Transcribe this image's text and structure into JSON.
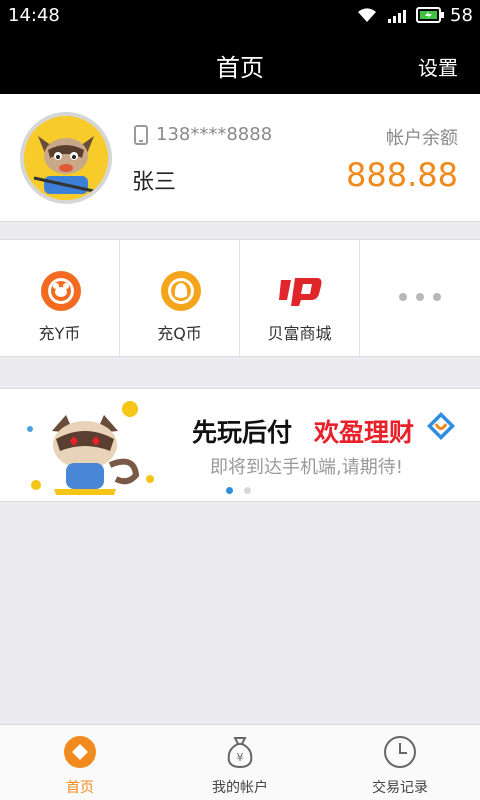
{
  "status_bar": {
    "time": "14:48",
    "battery_percent": "58"
  },
  "navbar": {
    "title": "首页",
    "settings_label": "设置"
  },
  "account": {
    "phone": "138****8888",
    "name": "张三",
    "balance_label": "帐户余额",
    "balance_value": "888.88"
  },
  "shortcuts": [
    {
      "label": "充Y币",
      "icon": "y-coin-icon"
    },
    {
      "label": "充Q币",
      "icon": "q-coin-icon"
    },
    {
      "label": "贝富商城",
      "icon": "up-mall-icon"
    },
    {
      "label": "",
      "icon": "more-dots-icon"
    }
  ],
  "banner": {
    "title_part1": "先玩后付",
    "title_part2": "欢盈理财",
    "subtitle": "即将到达手机端,请期待!",
    "page_index": 1,
    "page_count": 2
  },
  "tabs": [
    {
      "label": "首页",
      "icon": "home-icon",
      "active": true
    },
    {
      "label": "我的帐户",
      "icon": "money-bag-icon",
      "active": false
    },
    {
      "label": "交易记录",
      "icon": "clock-icon",
      "active": false
    }
  ],
  "colors": {
    "accent": "#f08a1c",
    "highlight_red": "#e8202a",
    "header_bg": "#000000",
    "page_bg": "#ececf0"
  }
}
